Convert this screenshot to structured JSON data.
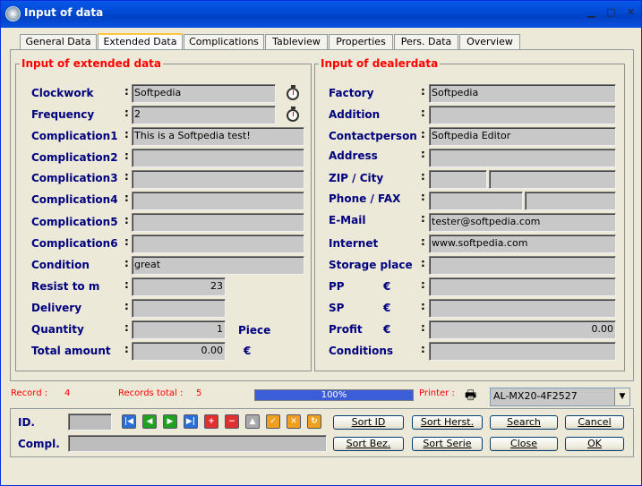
{
  "window": {
    "title": "Input of data"
  },
  "tabs": [
    "General Data",
    "Extended Data",
    "Complications",
    "Tableview",
    "Properties",
    "Pers. Data",
    "Overview"
  ],
  "left": {
    "legend": "Input of extended data",
    "fields": [
      {
        "label": "Clockwork",
        "value": "Softpedia"
      },
      {
        "label": "Frequency",
        "value": "2"
      },
      {
        "label": "Complication1",
        "value": "This is a Softpedia test!"
      },
      {
        "label": "Complication2",
        "value": ""
      },
      {
        "label": "Complication3",
        "value": ""
      },
      {
        "label": "Complication4",
        "value": ""
      },
      {
        "label": "Complication5",
        "value": ""
      },
      {
        "label": "Complication6",
        "value": ""
      },
      {
        "label": "Condition",
        "value": "great"
      },
      {
        "label": "Resist to m",
        "value": "23"
      },
      {
        "label": "Delivery",
        "value": ""
      },
      {
        "label": "Quantity",
        "value": "1"
      },
      {
        "label": "Total amount",
        "value": "0.00"
      }
    ],
    "unit_piece": "Piece",
    "unit_euro": "€"
  },
  "right": {
    "legend": "Input of dealerdata",
    "fields": [
      {
        "label": "Factory",
        "value": "Softpedia"
      },
      {
        "label": "Addition",
        "value": ""
      },
      {
        "label": "Contactperson",
        "value": "Softpedia Editor"
      },
      {
        "label": "Address",
        "value": ""
      },
      {
        "label": "ZIP / City",
        "value": "",
        "value2": ""
      },
      {
        "label": "Phone / FAX",
        "value": "",
        "value2": ""
      },
      {
        "label": "E-Mail",
        "value": "tester@softpedia.com"
      },
      {
        "label": "Internet",
        "value": "www.softpedia.com"
      },
      {
        "label": "Storage place",
        "value": ""
      },
      {
        "label": "PP",
        "value": ""
      },
      {
        "label": "SP",
        "value": ""
      },
      {
        "label": "Profit",
        "value": "0.00"
      },
      {
        "label": "Conditions",
        "value": ""
      }
    ],
    "euro": "€"
  },
  "status": {
    "record_label": "Record :",
    "record_value": "4",
    "total_label": "Records total :",
    "total_value": "5",
    "progress_text": "100%",
    "progress": 1.0,
    "printer_label": "Printer :",
    "printer_value": "AL-MX20-4F2527"
  },
  "bottom": {
    "id_label": "ID.",
    "compl_label": "Compl.",
    "id_value": "",
    "compl_value": "",
    "buttons": {
      "sort_id": "Sort ID",
      "sort_herst": "Sort Herst.",
      "search": "Search",
      "cancel": "Cancel",
      "sort_bez": "Sort Bez.",
      "sort_serie": "Sort Serie",
      "close": "Close",
      "ok": "OK"
    },
    "nav_icons": [
      "first-icon",
      "previous-icon",
      "next-icon",
      "last-icon",
      "add-icon",
      "delete-icon",
      "up-icon",
      "confirm-icon",
      "discard-icon",
      "refresh-icon"
    ]
  }
}
